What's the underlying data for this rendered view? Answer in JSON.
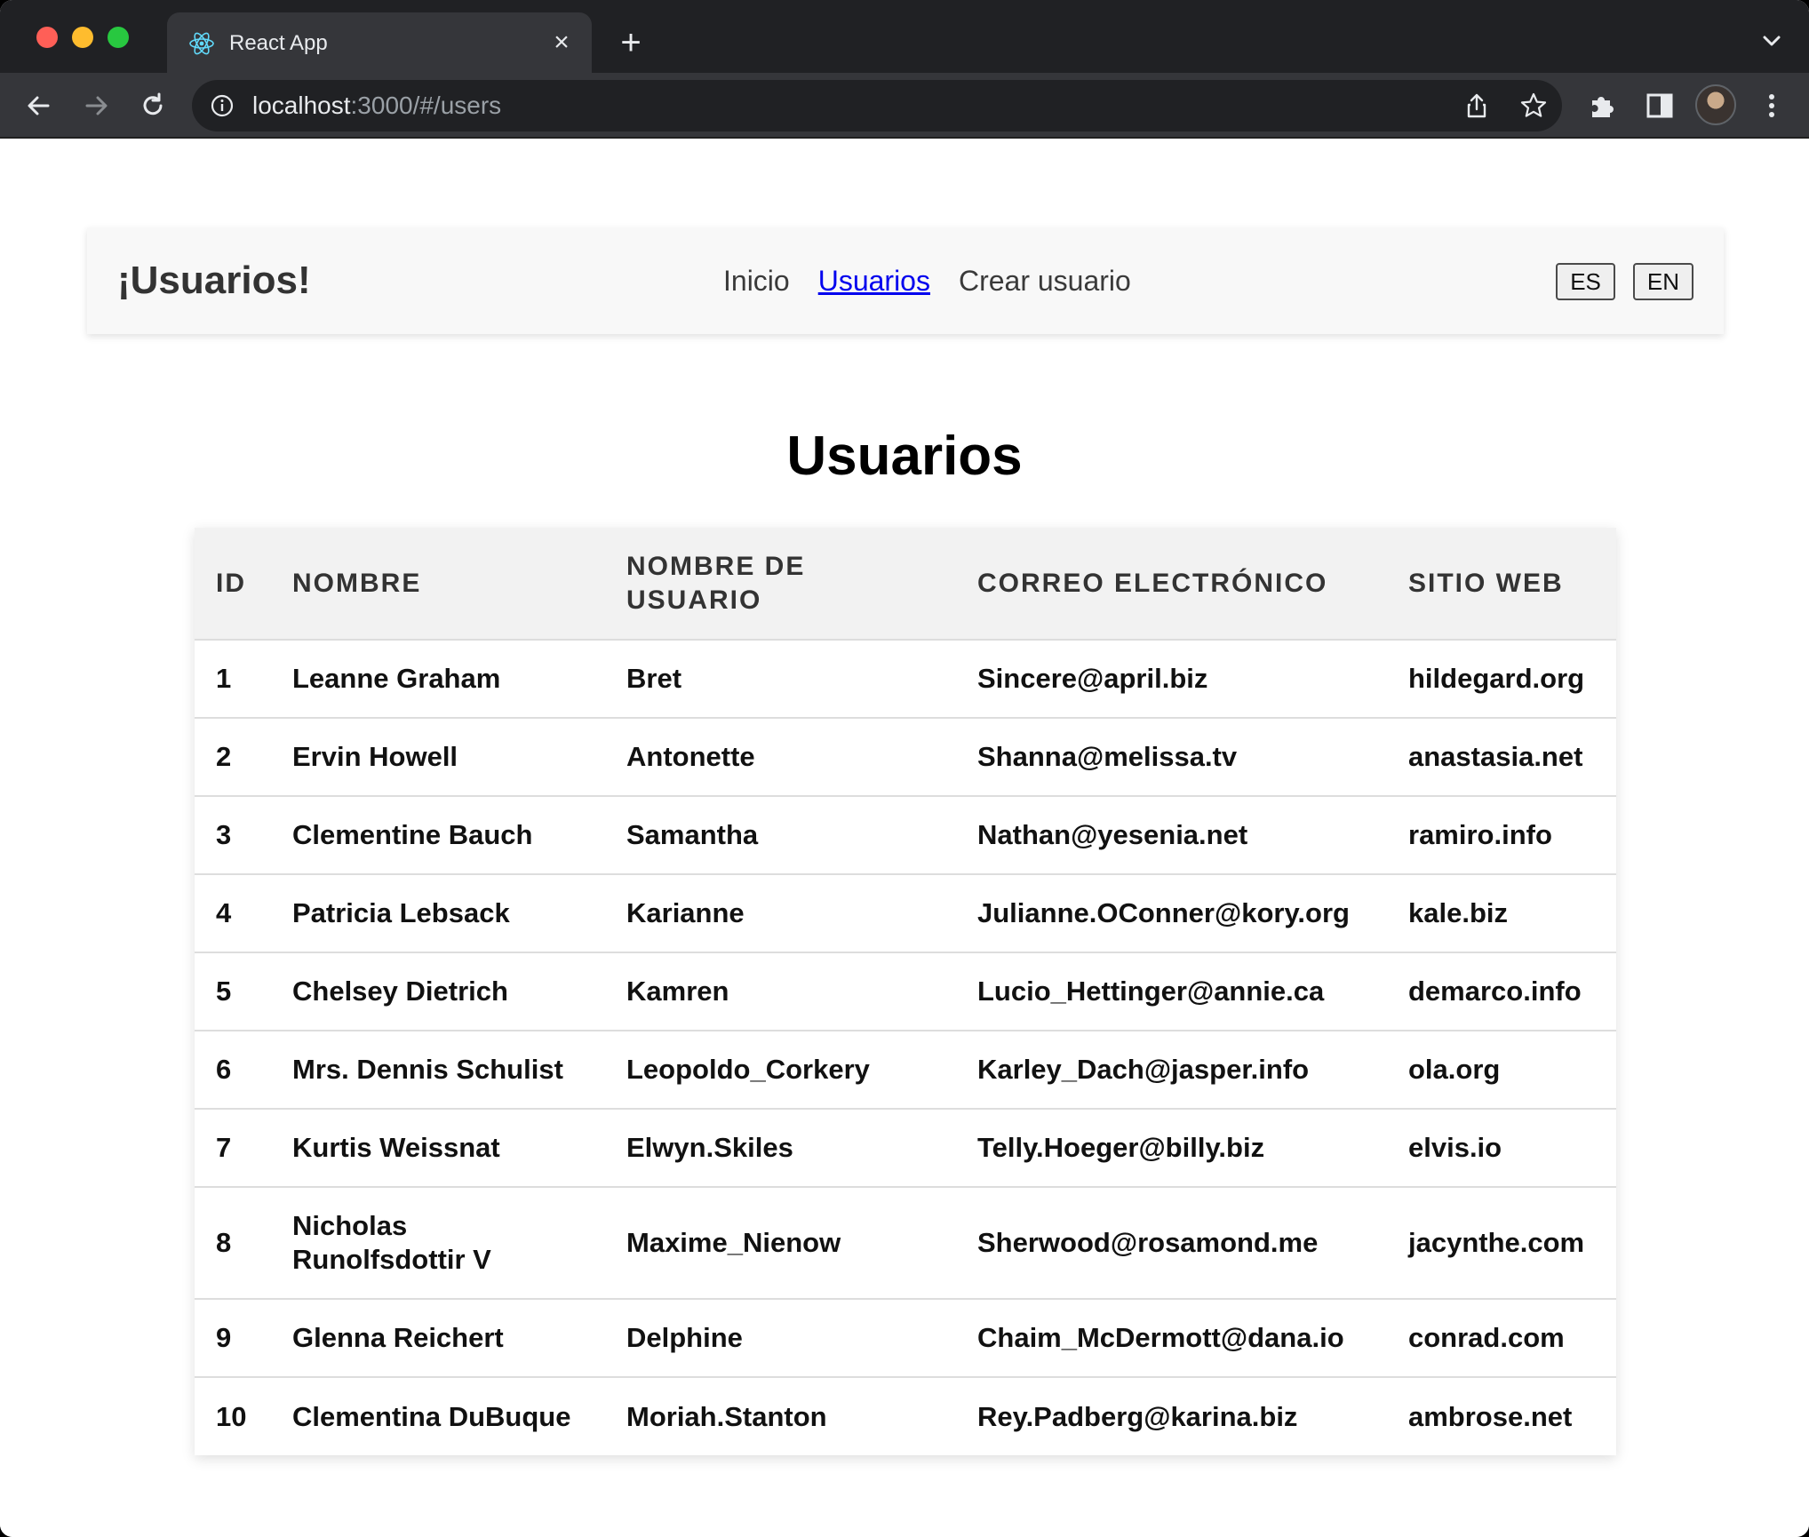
{
  "browser": {
    "tab_title": "React App",
    "url_host": "localhost",
    "url_path": ":3000/#/users"
  },
  "navbar": {
    "brand": "¡Usuarios!",
    "links": [
      {
        "label": "Inicio"
      },
      {
        "label": "Usuarios"
      },
      {
        "label": "Crear usuario"
      }
    ],
    "lang_buttons": [
      "ES",
      "EN"
    ]
  },
  "page": {
    "title": "Usuarios"
  },
  "table": {
    "headers": [
      "ID",
      "NOMBRE",
      "NOMBRE DE USUARIO",
      "CORREO ELECTRÓNICO",
      "SITIO WEB"
    ],
    "rows": [
      [
        "1",
        "Leanne Graham",
        "Bret",
        "Sincere@april.biz",
        "hildegard.org"
      ],
      [
        "2",
        "Ervin Howell",
        "Antonette",
        "Shanna@melissa.tv",
        "anastasia.net"
      ],
      [
        "3",
        "Clementine Bauch",
        "Samantha",
        "Nathan@yesenia.net",
        "ramiro.info"
      ],
      [
        "4",
        "Patricia Lebsack",
        "Karianne",
        "Julianne.OConner@kory.org",
        "kale.biz"
      ],
      [
        "5",
        "Chelsey Dietrich",
        "Kamren",
        "Lucio_Hettinger@annie.ca",
        "demarco.info"
      ],
      [
        "6",
        "Mrs. Dennis Schulist",
        "Leopoldo_Corkery",
        "Karley_Dach@jasper.info",
        "ola.org"
      ],
      [
        "7",
        "Kurtis Weissnat",
        "Elwyn.Skiles",
        "Telly.Hoeger@billy.biz",
        "elvis.io"
      ],
      [
        "8",
        "Nicholas Runolfsdottir V",
        "Maxime_Nienow",
        "Sherwood@rosamond.me",
        "jacynthe.com"
      ],
      [
        "9",
        "Glenna Reichert",
        "Delphine",
        "Chaim_McDermott@dana.io",
        "conrad.com"
      ],
      [
        "10",
        "Clementina DuBuque",
        "Moriah.Stanton",
        "Rey.Padberg@karina.biz",
        "ambrose.net"
      ]
    ]
  },
  "colors": {
    "chrome_dark": "#202124",
    "chrome_tab": "#35363a",
    "link_active": "#0000ee",
    "navbar_bg": "#f8f8f8",
    "table_header_bg": "#f2f2f2"
  }
}
